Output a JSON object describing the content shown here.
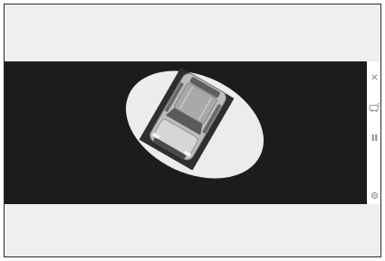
{
  "screen": {
    "view": "panoramic-view",
    "right_icons": [
      "close-icon",
      "camera-view-icon",
      "pause-icon",
      "settings-icon"
    ]
  }
}
